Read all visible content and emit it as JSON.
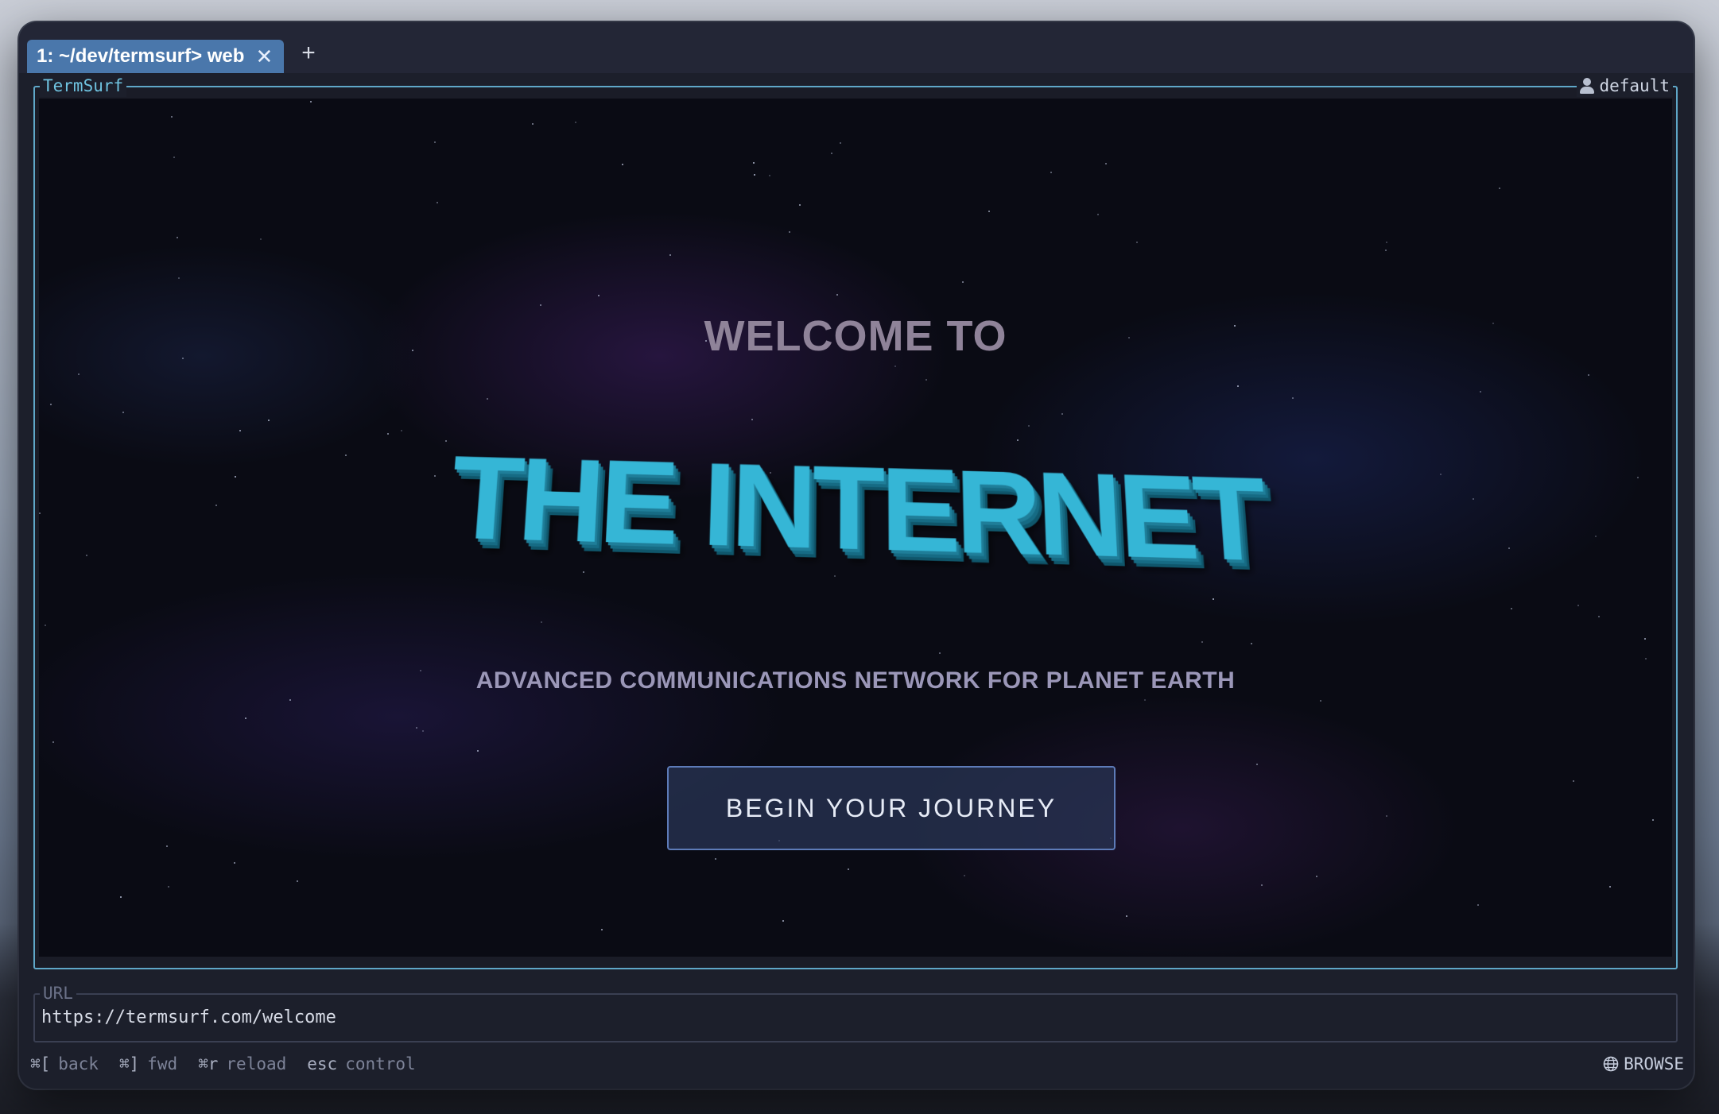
{
  "tabbar": {
    "tab_label": "1: ~/dev/termsurf> web",
    "close_glyph": "✕",
    "new_tab_glyph": "+"
  },
  "frame": {
    "app_label": "TermSurf",
    "profile_label": "default",
    "profile_icon": "user-icon"
  },
  "page": {
    "welcome": "WELCOME TO",
    "headline": "THE INTERNET",
    "tagline": "ADVANCED COMMUNICATIONS NETWORK FOR PLANET EARTH",
    "cta_label": "BEGIN YOUR JOURNEY"
  },
  "url_bar": {
    "label": "URL",
    "value": "https://termsurf.com/welcome"
  },
  "statusbar": {
    "hints": [
      {
        "key": "⌘[",
        "action": "back"
      },
      {
        "key": "⌘]",
        "action": "fwd"
      },
      {
        "key": "⌘r",
        "action": "reload"
      },
      {
        "key": "esc",
        "action": "control"
      }
    ],
    "mode_icon": "globe-icon",
    "mode_label": "BROWSE"
  },
  "colors": {
    "accent_tab": "#4a77ab",
    "frame_border": "#5fa7c8",
    "headline": "#35b6d6",
    "cta_border": "#5d7bb8"
  }
}
